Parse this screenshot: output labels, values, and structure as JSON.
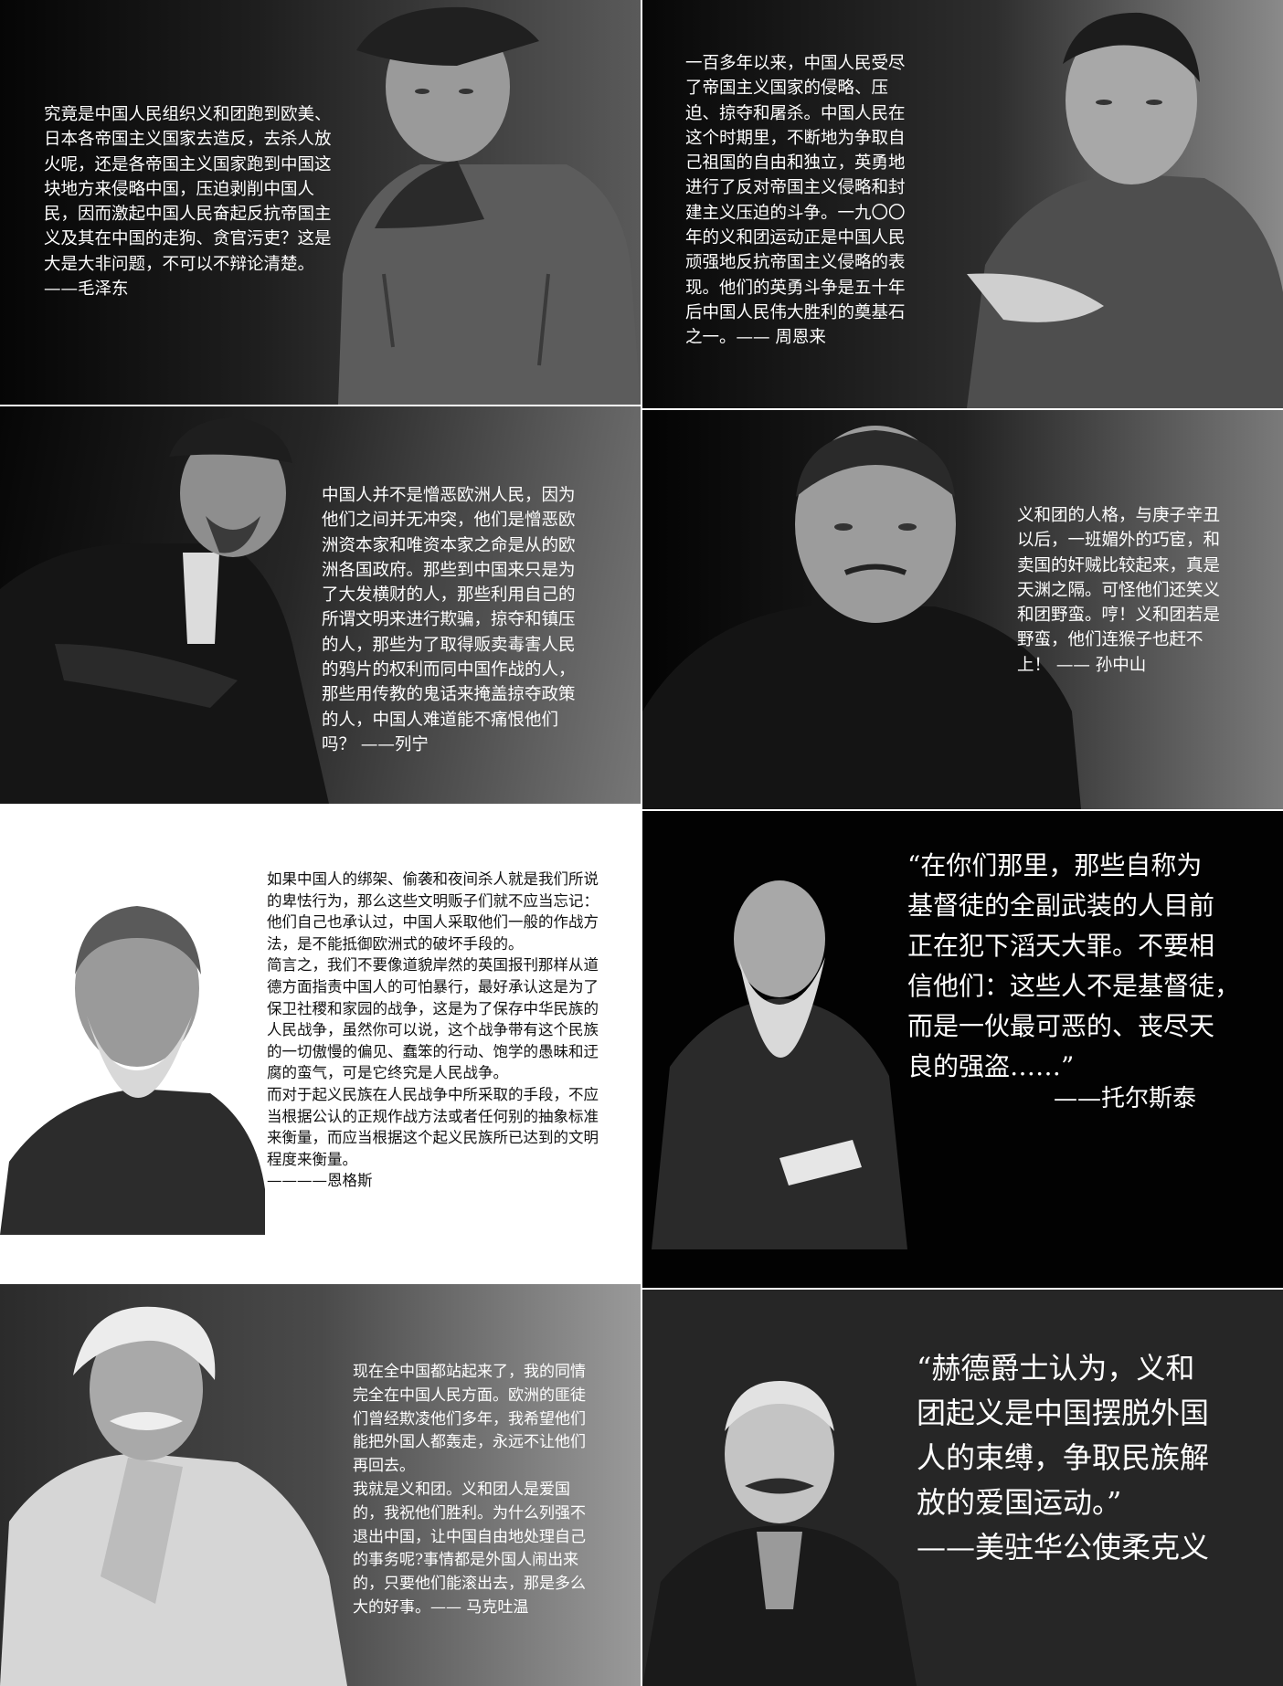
{
  "panels": [
    {
      "id": "mao",
      "quote": "究竟是中国人民组织义和团跑到欧美、\n日本各帝国主义国家去造反，去杀人放\n火呢，还是各帝国主义国家跑到中国这\n块地方来侵略中国，压迫剥削中国人\n民，因而激起中国人民奋起反抗帝国主\n义及其在中国的走狗、贪官污吏？这是\n大是大非问题，不可以不辩论清楚。\n——毛泽东"
    },
    {
      "id": "zhou",
      "quote": "一百多年以来，中国人民受尽\n了帝国主义国家的侵略、压\n迫、掠夺和屠杀。中国人民在\n这个时期里，不断地为争取自\n己祖国的自由和独立，英勇地\n进行了反对帝国主义侵略和封\n建主义压迫的斗争。一九〇〇\n年的义和团运动正是中国人民\n顽强地反抗帝国主义侵略的表\n现。他们的英勇斗争是五十年\n后中国人民伟大胜利的奠基石\n之一。—— 周恩来"
    },
    {
      "id": "lenin",
      "quote": "中国人并不是憎恶欧洲人民，因为\n他们之间并无冲突，他们是憎恶欧\n洲资本家和唯资本家之命是从的欧\n洲各国政府。那些到中国来只是为\n了大发横财的人，那些利用自己的\n所谓文明来进行欺骗，掠夺和镇压\n的人，那些为了取得贩卖毒害人民\n的鸦片的权利而同中国作战的人，\n那些用传教的鬼话来掩盖掠夺政策\n的人，中国人难道能不痛恨他们\n吗？ ——列宁"
    },
    {
      "id": "sun",
      "quote": "义和团的人格，与庚子辛丑\n以后，一班媚外的巧宦，和\n卖国的奸贼比较起来，真是\n天渊之隔。可怪他们还笑义\n和团野蛮。哼！义和团若是\n野蛮，他们连猴子也赶不\n上！ —— 孙中山"
    },
    {
      "id": "engels",
      "quote": "如果中国人的绑架、偷袭和夜间杀人就是我们所说\n的卑怯行为，那么这些文明贩子们就不应当忘记：\n他们自己也承认过，中国人采取他们一般的作战方\n法，是不能抵御欧洲式的破坏手段的。\n简言之，我们不要像道貌岸然的英国报刊那样从道\n德方面指责中国人的可怕暴行，最好承认这是为了\n保卫社稷和家园的战争，这是为了保存中华民族的\n人民战争，虽然你可以说，这个战争带有这个民族\n的一切傲慢的偏见、蠢笨的行动、饱学的愚昧和迂\n腐的蛮气，可是它终究是人民战争。\n而对于起义民族在人民战争中所采取的手段，不应\n当根据公认的正规作战方法或者任何别的抽象标准\n来衡量，而应当根据这个起义民族所已达到的文明\n程度来衡量。\n————恩格斯"
    },
    {
      "id": "tolstoy",
      "quote": "“在你们那里，那些自称为\n基督徒的全副武装的人目前\n正在犯下滔天大罪。不要相\n信他们：这些人不是基督徒，\n而是一伙最可恶的、丧尽天\n良的强盗……”",
      "attribution": "——托尔斯泰"
    },
    {
      "id": "twain",
      "quote": "现在全中国都站起来了，我的同情\n完全在中国人民方面。欧洲的匪徒\n们曾经欺凌他们多年，我希望他们\n能把外国人都轰走，永远不让他们\n再回去。\n我就是义和团。义和团人是爱国\n的，我祝他们胜利。为什么列强不\n退出中国，让中国自由地处理自己\n的事务呢?事情都是外国人闹出来\n的，只要他们能滚出去，那是多么\n大的好事。—— 马克吐温"
    },
    {
      "id": "rockhill",
      "quote": "“赫德爵士认为，义和\n团起义是中国摆脱外国\n人的束缚，争取民族解\n放的爱国运动。”\n——美驻华公使柔克义"
    }
  ]
}
